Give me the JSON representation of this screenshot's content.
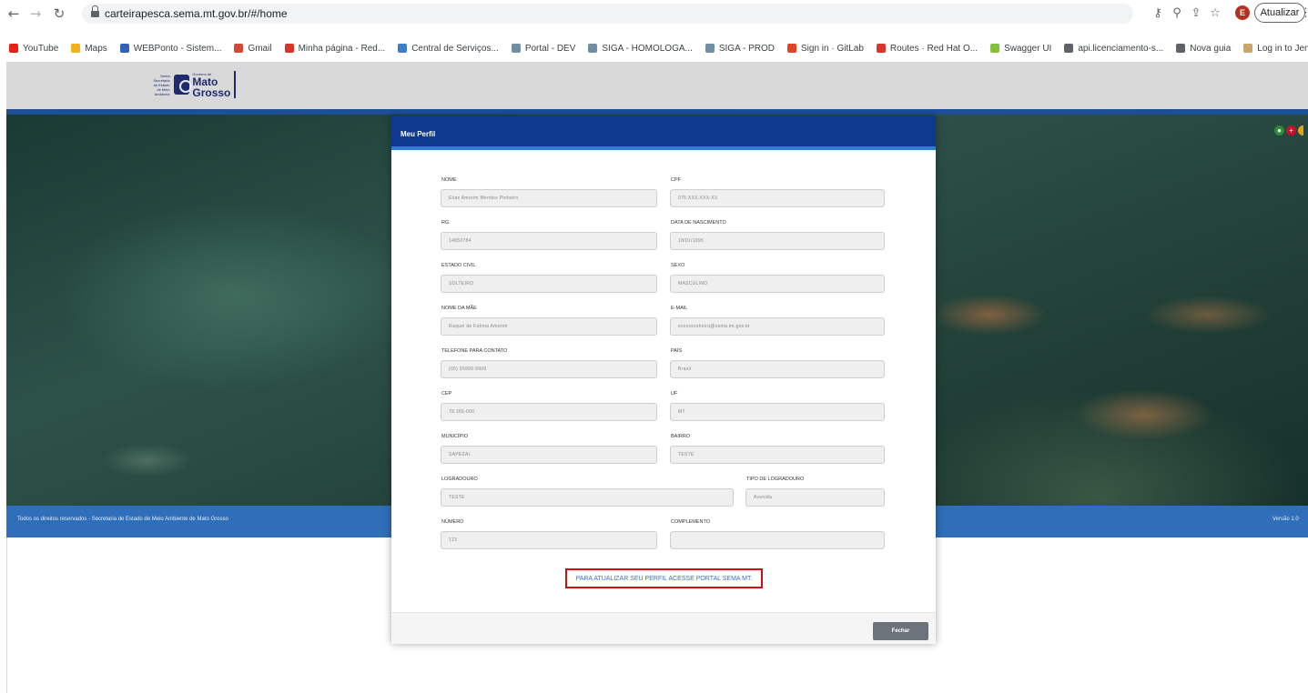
{
  "browser": {
    "url": "carteirapesca.sema.mt.gov.br/#/home",
    "update_label": "Atualizar",
    "avatar_initial": "E",
    "bookmarks": [
      {
        "label": "YouTube",
        "color": "#e62117"
      },
      {
        "label": "Maps",
        "color": "#f2b01e"
      },
      {
        "label": "WEBPonto - Sistem...",
        "color": "#2f63b9"
      },
      {
        "label": "Gmail",
        "color": "#d44638"
      },
      {
        "label": "Minha página - Red...",
        "color": "#d9352a"
      },
      {
        "label": "Central de Serviços...",
        "color": "#3d7cc9"
      },
      {
        "label": "Portal - DEV",
        "color": "#6f8e9f"
      },
      {
        "label": "SIGA - HOMOLOGA...",
        "color": "#6f8e9f"
      },
      {
        "label": "SIGA - PROD",
        "color": "#6f8e9f"
      },
      {
        "label": "Sign in · GitLab",
        "color": "#e2432a"
      },
      {
        "label": "Routes · Red Hat O...",
        "color": "#d9352a"
      },
      {
        "label": "Swagger UI",
        "color": "#85c03a"
      },
      {
        "label": "api.licenciamento-s...",
        "color": "#5f6368"
      },
      {
        "label": "Nova guia",
        "color": "#5f6368"
      },
      {
        "label": "Log in to Jenkins us...",
        "color": "#c9a56b"
      }
    ]
  },
  "site": {
    "logo": {
      "small_text": "Sema Secretaria de Estado de Meio Ambiente",
      "tiny_text": "Governo de",
      "line1": "Mato",
      "line2": "Grosso"
    },
    "footer_text": "Todos os direitos reservados - Secretaria de Estado de Meio Ambiente de Mato Grosso",
    "version": "Versão 1.0"
  },
  "modal": {
    "title": "Meu Perfil",
    "fields": {
      "nome": {
        "label": "NOME",
        "value": "Elias Amorim Mendes Pinheiro"
      },
      "cpf": {
        "label": "CPF",
        "value": "075.XXX.XXX-XX"
      },
      "rg": {
        "label": "RG",
        "value": "14850784"
      },
      "nascimento": {
        "label": "DATA DE NASCIMENTO",
        "value": "18/01/1995"
      },
      "estado_civil": {
        "label": "ESTADO CIVIL",
        "value": "SOLTEIRO"
      },
      "sexo": {
        "label": "SEXO",
        "value": "MASCULINO"
      },
      "mae": {
        "label": "NOME DA MÃE",
        "value": "Raquel de Fatima Amorim"
      },
      "email": {
        "label": "E-MAIL",
        "value": "exxxxxxxheiro@sema.mt.gov.br"
      },
      "telefone": {
        "label": "TELEFONE PARA CONTATO",
        "value": "(65) 99999-9999"
      },
      "pais": {
        "label": "PAÍS",
        "value": "Brasil"
      },
      "cep": {
        "label": "CEP",
        "value": "78.365-000"
      },
      "uf": {
        "label": "UF",
        "value": "MT"
      },
      "municipio": {
        "label": "MUNICÍPIO",
        "value": "SAPEZAL"
      },
      "bairro": {
        "label": "BAIRRO",
        "value": "TESTE"
      },
      "logradouro": {
        "label": "LOGRADOURO",
        "value": "TESTE"
      },
      "tipo_logradouro": {
        "label": "TIPO DE LOGRADOURO",
        "value": "Avenida"
      },
      "numero": {
        "label": "NÚMERO",
        "value": "123"
      },
      "complemento": {
        "label": "COMPLEMENTO",
        "value": ""
      }
    },
    "update_link": "PARA ATUALIZAR SEU PERFIL ACESSE PORTAL SEMA MT.",
    "close_label": "Fechar"
  }
}
